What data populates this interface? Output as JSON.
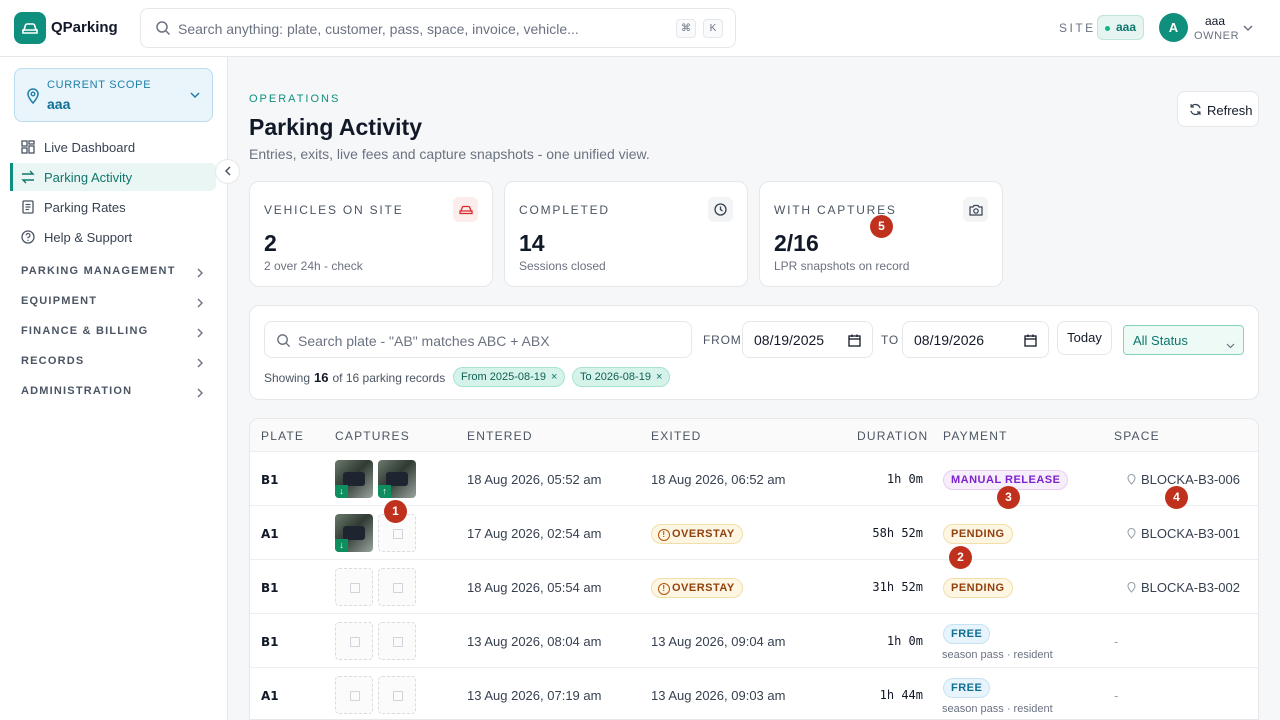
{
  "app": {
    "name": "QParking"
  },
  "search": {
    "placeholder": "Search anything: plate, customer, pass, space, invoice, vehicle...",
    "kbd1": "⌘",
    "kbd2": "K"
  },
  "site": {
    "label": "SITE",
    "value": "aaa"
  },
  "user": {
    "initial": "A",
    "name": "aaa",
    "role": "OWNER"
  },
  "scope": {
    "label": "CURRENT SCOPE",
    "value": "aaa"
  },
  "nav": [
    {
      "label": "Live Dashboard",
      "icon": "dashboard-icon"
    },
    {
      "label": "Parking Activity",
      "icon": "swap-icon",
      "active": true
    },
    {
      "label": "Parking Rates",
      "icon": "receipt-icon"
    },
    {
      "label": "Help & Support",
      "icon": "help-icon"
    }
  ],
  "sections": [
    "PARKING MANAGEMENT",
    "EQUIPMENT",
    "FINANCE & BILLING",
    "RECORDS",
    "ADMINISTRATION"
  ],
  "header": {
    "eyebrow": "OPERATIONS",
    "title": "Parking Activity",
    "subtitle": "Entries, exits, live fees and capture snapshots - one unified view.",
    "refresh": "Refresh"
  },
  "stats": [
    {
      "label": "VEHICLES ON SITE",
      "value": "2",
      "sub": "2 over 24h - check",
      "icon": "car-icon"
    },
    {
      "label": "COMPLETED",
      "value": "14",
      "sub": "Sessions closed",
      "icon": "clock-icon"
    },
    {
      "label": "WITH CAPTURES",
      "value": "2/16",
      "sub": "LPR snapshots on record",
      "icon": "camera-icon"
    }
  ],
  "markers": [
    "1",
    "2",
    "3",
    "4",
    "5"
  ],
  "filters": {
    "placeholder": "Search plate - \"AB\" matches ABC + ABX",
    "from_label": "FROM",
    "from": "08/19/2025",
    "to_label": "TO",
    "to": "08/19/2026",
    "today": "Today",
    "status": "All Status",
    "showing_prefix": "Showing",
    "showing_count": "16",
    "showing_suffix": "of 16 parking records",
    "chips": [
      "From 2025-08-19",
      "To 2026-08-19"
    ]
  },
  "table": {
    "columns": [
      "PLATE",
      "CAPTURES",
      "ENTERED",
      "EXITED",
      "DURATION",
      "PAYMENT",
      "SPACE"
    ],
    "rows": [
      {
        "plate": "B1",
        "entered": "18 Aug 2026, 05:52 am",
        "exited": "18 Aug 2026, 06:52 am",
        "duration": "1h 0m",
        "payment": "MANUAL RELEASE",
        "space": "BLOCKA-B3-006"
      },
      {
        "plate": "A1",
        "entered": "17 Aug 2026, 02:54 am",
        "exited": "OVERSTAY",
        "duration": "58h 52m",
        "payment": "PENDING",
        "space": "BLOCKA-B3-001"
      },
      {
        "plate": "B1",
        "entered": "18 Aug 2026, 05:54 am",
        "exited": "OVERSTAY",
        "duration": "31h 52m",
        "payment": "PENDING",
        "space": "BLOCKA-B3-002"
      },
      {
        "plate": "B1",
        "entered": "13 Aug 2026, 08:04 am",
        "exited": "13 Aug 2026, 09:04 am",
        "duration": "1h 0m",
        "payment": "FREE",
        "payment_note": "season pass · resident",
        "space": "-"
      },
      {
        "plate": "A1",
        "entered": "13 Aug 2026, 07:19 am",
        "exited": "13 Aug 2026, 09:03 am",
        "duration": "1h 44m",
        "payment": "FREE",
        "payment_note": "season pass · resident",
        "space": "-"
      }
    ]
  },
  "colors": {
    "brand": "#0f8f7d",
    "marker": "#c0311d",
    "manual": "#7e22ce",
    "pending": "#92400e",
    "free": "#0e6e95"
  }
}
